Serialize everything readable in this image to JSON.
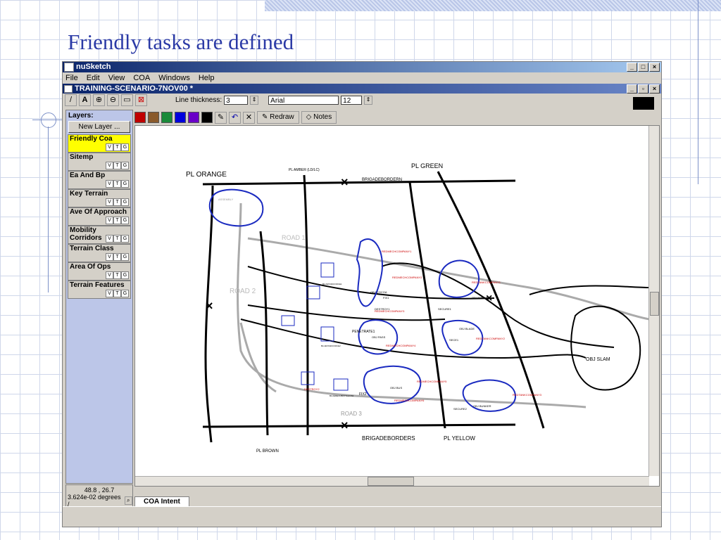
{
  "slide": {
    "title": "Friendly tasks are defined"
  },
  "app": {
    "window_title": "nuSketch",
    "menu": [
      "File",
      "Edit",
      "View",
      "COA",
      "Windows",
      "Help"
    ],
    "doc_title": "TRAINING-SCENARIO-7NOV00 *",
    "toolbar": {
      "line_thickness_label": "Line thickness:",
      "line_thickness_value": "3",
      "font_value": "Arial",
      "font_size_value": "12",
      "redraw_label": "Redraw",
      "notes_label": "Notes"
    },
    "colors": [
      "#c00000",
      "#8a5a2b",
      "#1a8a3a",
      "#0000dd",
      "#6a00c8",
      "#000000"
    ],
    "layers_title": "Layers:",
    "new_layer_label": "New Layer ...",
    "layers": [
      {
        "name": "Friendly Coa",
        "active": true
      },
      {
        "name": "Sitemp",
        "active": false
      },
      {
        "name": "Ea And Bp",
        "active": false
      },
      {
        "name": "Key Terrain",
        "active": false
      },
      {
        "name": "Ave Of Approach",
        "active": false
      },
      {
        "name": "Mobility Corridors",
        "active": false
      },
      {
        "name": "Terrain Class",
        "active": false
      },
      {
        "name": "Area Of Ops",
        "active": false
      },
      {
        "name": "Terrain Features",
        "active": false
      }
    ],
    "vtg": [
      "V",
      "T",
      "G"
    ],
    "coords": {
      "xy": "48.8   ,  26.7",
      "degrees": "3.624e-02 degrees /"
    },
    "tab_label": "COA Intent"
  },
  "map": {
    "labels": {
      "pl_orange": "PL ORANGE",
      "pl_amber": "PL AMBER (LD/LC)",
      "pl_green": "PL GREEN",
      "brigade_border_top": "BRIGADEBORDERN",
      "brigade_border_bottom": "BRIGADEBORDERS",
      "pl_brown": "PL BROWN",
      "pl_yellow": "PL YELLOW",
      "road1": "ROAD 1",
      "road2": "ROAD 2",
      "road3": "ROAD 3",
      "obj_slam": "OBJ SLAM",
      "obj_marne": "OBJ MARNE",
      "obj_cocoa": "OBJ COCOA",
      "obj_pass": "OBJ PASS",
      "obj_bus": "OBJ BUS",
      "obj_bunker": "OBJ BUNKER",
      "obj_blade": "OBJ BLADE",
      "rc1": "REDMECHCOMPANY1",
      "rc2": "REDMECHCOMPANY2",
      "rc3": "REDMECHCOMPANY3",
      "rc4": "REDMECHCOMPANY4",
      "rc5": "REDMECHCOMPANY5",
      "rc6": "REDMECHCOMPANY6",
      "rt1": "REDTANKCOMPANY1",
      "rt2": "REDTANKCOMPANY2",
      "rt3": "REDTANKCOMPANY3",
      "secure1": "SECURE1",
      "secure2": "SECURE2",
      "sece1": "SECE1",
      "fix1": "FIX1",
      "fix2": "FIX2",
      "penetrate1": "PENETRATE1",
      "destroy1": "DESTROY1",
      "destroy2": "DESTROY2",
      "bluetask1": "BLUETASKFORCE1",
      "bluetask2": "BLUETASKFORCE2",
      "bluemech": "BLUEMECHBATTALION1",
      "assembly": "ASSEMBLY"
    }
  }
}
